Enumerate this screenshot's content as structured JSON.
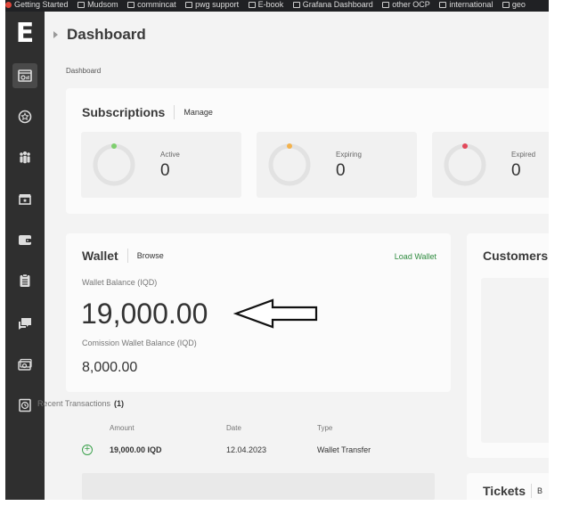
{
  "bookmarks": [
    {
      "label": "Getting Started",
      "icon": "red-dot-icon"
    },
    {
      "label": "Mudsom",
      "icon": "folder-icon"
    },
    {
      "label": "commincat",
      "icon": "folder-icon"
    },
    {
      "label": "pwg support",
      "icon": "folder-icon"
    },
    {
      "label": "E-book",
      "icon": "folder-icon"
    },
    {
      "label": "Grafana Dashboard",
      "icon": "folder-icon"
    },
    {
      "label": "other OCP",
      "icon": "folder-icon"
    },
    {
      "label": "international",
      "icon": "folder-icon"
    },
    {
      "label": "geo",
      "icon": "folder-icon"
    }
  ],
  "sidebar": {
    "logo": "E",
    "items": [
      {
        "name": "dashboard",
        "icon": "dashboard-icon",
        "active": true
      },
      {
        "name": "subscriptions",
        "icon": "star-badge-icon"
      },
      {
        "name": "customers",
        "icon": "people-icon"
      },
      {
        "name": "store",
        "icon": "store-icon"
      },
      {
        "name": "wallet",
        "icon": "wallet-icon"
      },
      {
        "name": "reports",
        "icon": "clipboard-icon"
      },
      {
        "name": "tickets",
        "icon": "chat-icon"
      },
      {
        "name": "billing",
        "icon": "money-icon"
      },
      {
        "name": "history",
        "icon": "history-icon"
      }
    ]
  },
  "page": {
    "title": "Dashboard",
    "breadcrumb": "Dashboard"
  },
  "subscriptions": {
    "title": "Subscriptions",
    "manage": "Manage",
    "stats": [
      {
        "label": "Active",
        "value": "0",
        "color": "#7ecf6e"
      },
      {
        "label": "Expiring",
        "value": "0",
        "color": "#f3b24d"
      },
      {
        "label": "Expired",
        "value": "0",
        "color": "#e2485a"
      }
    ]
  },
  "wallet": {
    "title": "Wallet",
    "browse": "Browse",
    "load_wallet": "Load Wallet",
    "balance_label": "Wallet Balance (IQD)",
    "balance": "19,000.00",
    "commission_label": "Comission Wallet Balance (IQD)",
    "commission": "8,000.00"
  },
  "transactions": {
    "title": "Recent Transactions",
    "count": "(1)",
    "columns": [
      "Amount",
      "Date",
      "Type"
    ],
    "rows": [
      {
        "amount": "19,000.00 IQD",
        "date": "12.04.2023",
        "type": "Wallet Transfer"
      }
    ]
  },
  "customers": {
    "title": "Customers"
  },
  "tickets": {
    "title": "Tickets",
    "link": "B"
  },
  "colors": {
    "sidebar": "#2f2f2f",
    "accent_green": "#2e8b3e",
    "background": "#f3f3f3"
  }
}
